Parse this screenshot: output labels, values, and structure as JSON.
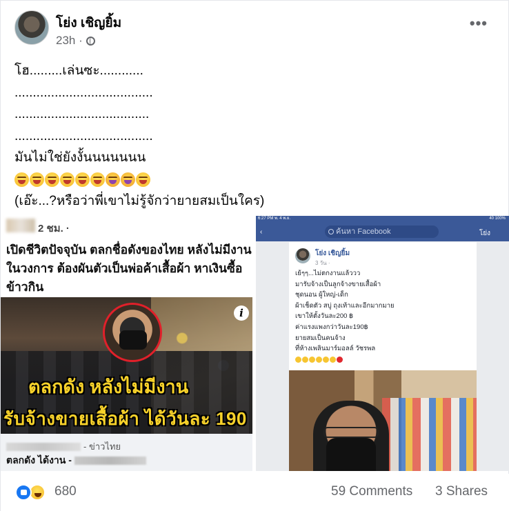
{
  "post": {
    "author": "โย่ง เชิญยิ้ม",
    "time": "23h ·",
    "privacy_icon": "globe-icon",
    "more_icon": "more-options-icon",
    "more_label": "•••",
    "lines": [
      "โฮ.........เล่นซะ............",
      "......................................",
      ".....................................",
      "......................................",
      "มันไม่ใช่ยังงั้นนนนนนน"
    ],
    "emoji_count": 9,
    "last_line": "(เอ๊ะ...?หรือว่าพี่เขาไม่รู้จักว่ายายสมเป็นใคร)"
  },
  "news_image": {
    "time": "2 ชม. ·",
    "headline": "เปิดชีวิตปัจจุบัน ตลกชื่อดังของไทย หลังไม่มีงาน ในวงการ ต้องผันตัวเป็นพ่อค้าเสื้อผ้า หาเงินซื้อข้าวกิน",
    "overlay_line1": "ตลกดัง  หลังไม่มีงาน",
    "overlay_line2": "รับจ้างขายเสื้อผ้า  ได้วันละ 190",
    "info_label": "i",
    "source_suffix": "- ข่าวไทย",
    "title_prefix": "ตลกดัง ได้งาน -"
  },
  "screenshot_image": {
    "status_left": "6:27 PM  พ. 4 พ.ย.",
    "status_right": "40 100%",
    "search_placeholder": "ค้นหา Facebook",
    "profile_name": "โย่ง",
    "author": "โย่ง เชิญยิ้ม",
    "time": "3 วัน ·",
    "lines": [
      "เย้ๆๆ...ไม่ตกงานแล้ววว",
      "มารับจ้างเป็นลูกจ้างขายเสื้อผ้า",
      "ชุดนอน ผู้ใหญ่-เด็ก",
      "ผ้าเช็ดตัว สบู่ ถุงเท้าและอีกมากมาย",
      "เขาให้ตั้งวันละ200 ฿",
      "ค่าแรงแพงกว่าวันละ190฿",
      "ยายสมเป็นคนจ้าง",
      "ที่ห้างเพลินมาร์มอลล์ วัชรพล"
    ]
  },
  "footer": {
    "reaction_icons": [
      "like-icon",
      "haha-icon"
    ],
    "reaction_count": "680",
    "comments": "59 Comments",
    "shares": "3 Shares"
  },
  "colors": {
    "facebook_blue": "#3b5998",
    "like_blue": "#1877f2",
    "secondary_text": "#65676b",
    "overlay_yellow": "#f8d22a"
  }
}
